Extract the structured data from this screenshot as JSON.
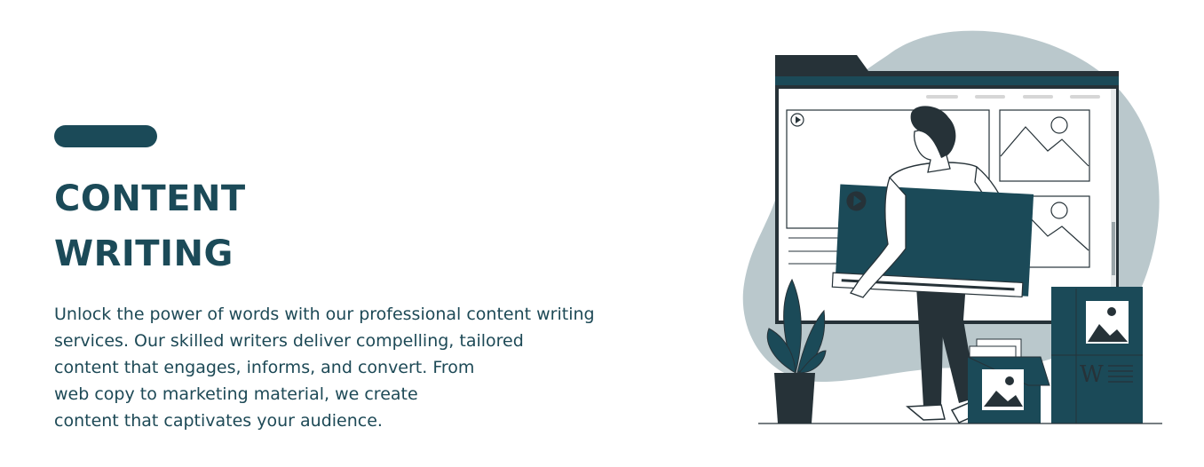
{
  "hero": {
    "title_lines": [
      "CONTENT",
      "WRITING"
    ],
    "description_lines": [
      "Unlock the power of words with our professional content writing",
      "services. Our skilled writers deliver compelling, tailored",
      "content that engages, informs, and convert. From",
      "web copy to marketing material, we create",
      "content that captivates your audience."
    ],
    "accent_color": "#1b4a58"
  },
  "illustration": {
    "doc_icon_letter": "W",
    "colors": {
      "teal": "#1b4a58",
      "dark": "#263238",
      "blob": "#bac8cc"
    }
  }
}
